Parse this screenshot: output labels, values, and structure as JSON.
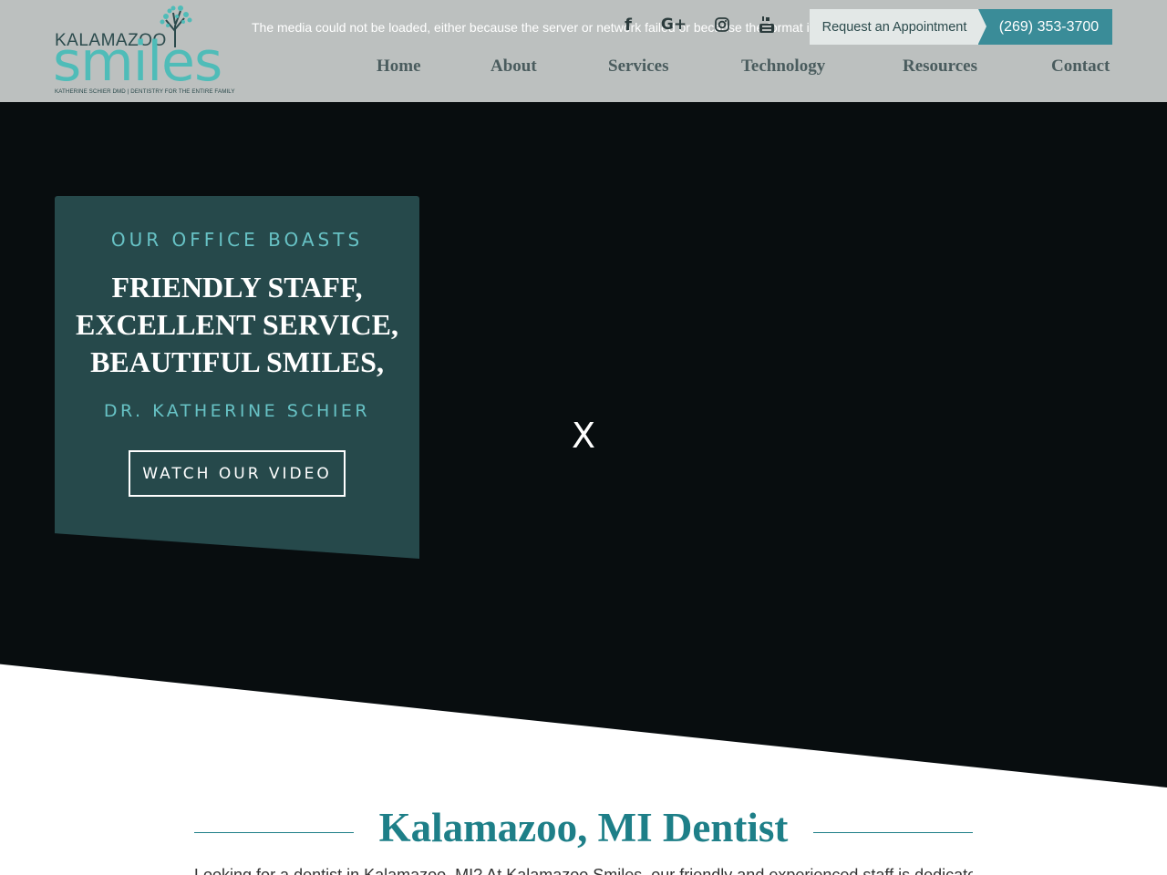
{
  "brand": {
    "logo_top": "KALAMAZOO",
    "logo_main": "smiles",
    "logo_tagline": "KATHERINE SCHIER DMD | DENTISTRY FOR THE ENTIRE FAMILY"
  },
  "media_error": "The media could not be loaded, either because the server or network failed or because the format is not supported.",
  "social": {
    "facebook_glyph": "f",
    "google_plus_glyph": "G+"
  },
  "header": {
    "appointment_label": "Request an Appointment",
    "phone_label": "(269) 353-3700"
  },
  "nav": {
    "items": [
      {
        "label": "Home"
      },
      {
        "label": "About"
      },
      {
        "label": "Services"
      },
      {
        "label": "Technology"
      },
      {
        "label": "Resources"
      },
      {
        "label": "Contact"
      }
    ]
  },
  "hero": {
    "eyebrow": "OUR OFFICE BOASTS",
    "headline_lines": [
      "FRIENDLY STAFF,",
      "EXCELLENT SERVICE,",
      "BEAUTIFUL SMILES,"
    ],
    "doctor": "DR. KATHERINE SCHIER",
    "video_button": "WATCH OUR VIDEO",
    "close_label": "X"
  },
  "section": {
    "title": "Kalamazoo, MI Dentist",
    "intro_partial": "Looking for a dentist in Kalamazoo, MI? At Kalamazoo Smiles, our friendly and experienced staff is dedicated to"
  },
  "colors": {
    "header_bg": "#bcc0bf",
    "accent_teal": "#4fbcb8",
    "card_bg": "#26494b",
    "phone_button": "#3a8c98",
    "title_teal": "#1e7f88",
    "hero_bg": "#080d0f"
  },
  "icons": [
    "facebook-icon",
    "google-plus-icon",
    "instagram-icon",
    "youtube-icon",
    "tree-icon"
  ]
}
